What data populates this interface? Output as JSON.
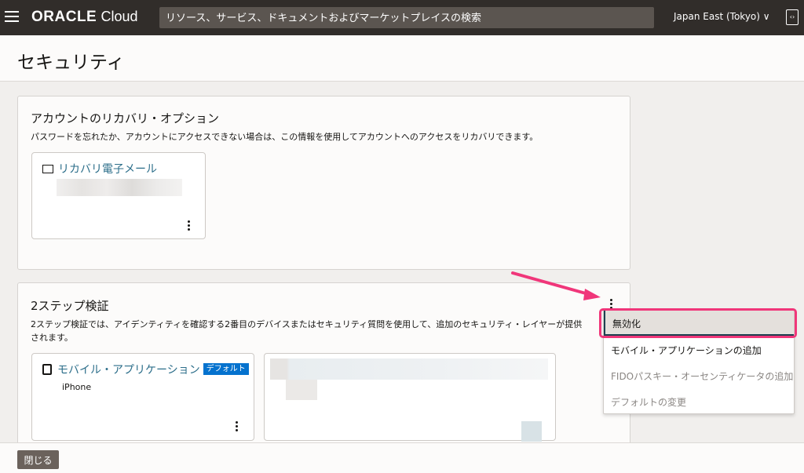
{
  "header": {
    "brand": "ORACLE",
    "brand_suffix": "Cloud",
    "search_placeholder": "リソース、サービス、ドキュメントおよびマーケットプレイスの検索",
    "region": "Japan East (Tokyo)",
    "region_chevron": "∨",
    "dev_tools_icon": "‹›"
  },
  "page": {
    "title": "セキュリティ"
  },
  "recovery": {
    "title": "アカウントのリカバリ・オプション",
    "description": "パスワードを忘れたか、アカウントにアクセスできない場合は、この情報を使用してアカウントへのアクセスをリカバリできます。",
    "email_card": {
      "label": "リカバリ電子メール",
      "icon": "envelope-icon"
    }
  },
  "two_step": {
    "title": "2ステップ検証",
    "description_line1": "2ステップ検証では、アイデンティティを確認する2番目のデバイスまたはセキュリティ質問を使用して、追加のセキュリティ・レイヤーが提供",
    "description_line2": "されます。",
    "mobile_card": {
      "label": "モバイル・アプリケーション",
      "badge": "デフォルト",
      "device": "iPhone"
    }
  },
  "menu": {
    "items": [
      {
        "label": "無効化",
        "state": "highlighted"
      },
      {
        "label": "モバイル・アプリケーションの追加",
        "state": "enabled"
      },
      {
        "label": "FIDOパスキー・オーセンティケータの追加",
        "state": "disabled"
      },
      {
        "label": "デフォルトの変更",
        "state": "disabled"
      }
    ]
  },
  "footer": {
    "close_label": "閉じる"
  },
  "colors": {
    "header": "#312d2a",
    "accent": "#0572ce",
    "highlight": "#f0367a",
    "link": "#2c6e8a"
  }
}
